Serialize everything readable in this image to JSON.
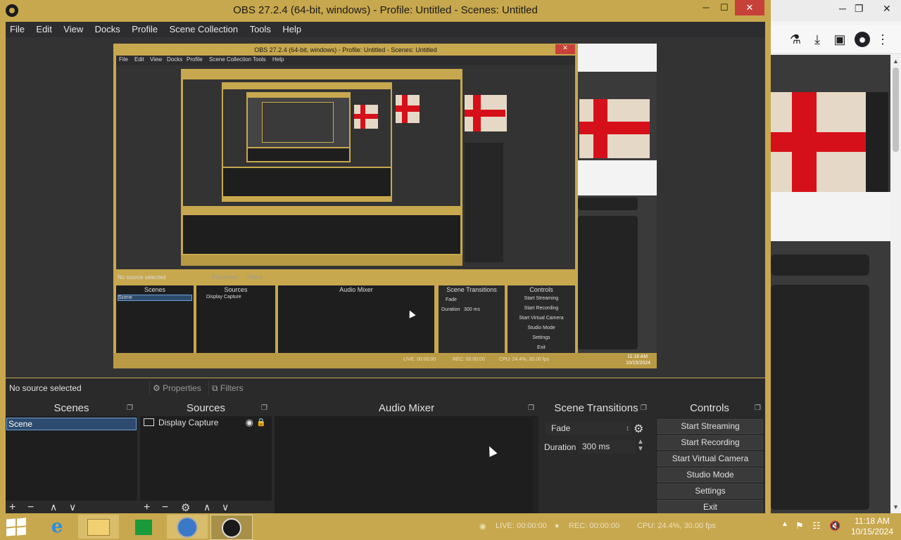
{
  "window": {
    "title": "OBS 27.2.4 (64-bit, windows) - Profile: Untitled - Scenes: Untitled",
    "minimize": "─",
    "maximize": "☐",
    "close": "✕"
  },
  "menu": [
    "File",
    "Edit",
    "View",
    "Docks",
    "Profile",
    "Scene Collection",
    "Tools",
    "Help"
  ],
  "properties_bar": {
    "no_source": "No source selected",
    "properties": "Properties",
    "filters": "Filters"
  },
  "docks": {
    "scenes": {
      "title": "Scenes",
      "items": [
        "Scene"
      ]
    },
    "sources": {
      "title": "Sources",
      "items": [
        "Display Capture"
      ]
    },
    "audio_mixer": {
      "title": "Audio Mixer"
    },
    "scene_transitions": {
      "title": "Scene Transitions",
      "transition": "Fade",
      "duration_label": "Duration",
      "duration_value": "300 ms"
    },
    "controls": {
      "title": "Controls",
      "buttons": [
        "Start Streaming",
        "Start Recording",
        "Start Virtual Camera",
        "Studio Mode",
        "Settings",
        "Exit"
      ]
    }
  },
  "status": {
    "live": "LIVE: 00:00:00",
    "rec": "REC: 00:00:00",
    "cpu": "CPU: 24.4%, 30.00 fps"
  },
  "clock": {
    "time": "11:18 AM",
    "date": "10/15/2024"
  },
  "nested_preview": {
    "title": "OBS 27.2.4 (64-bit, windows) - Profile: Untitled - Scenes: Untitled",
    "menu": [
      "File",
      "Edit",
      "View",
      "Docks",
      "Profile",
      "Scene Collection",
      "Tools",
      "Help"
    ],
    "no_source": "No source selected",
    "properties": "Properties",
    "filters": "Filters",
    "scenes": "Scenes",
    "sources": "Sources",
    "audio_mixer": "Audio Mixer",
    "scene_transitions": "Scene Transitions",
    "controls": "Controls",
    "scene_item": "Scene",
    "source_item": "Display Capture",
    "transition": "Fade",
    "duration_label": "Duration",
    "duration_value": "300 ms",
    "buttons": [
      "Start Streaming",
      "Start Recording",
      "Start Virtual Camera",
      "Studio Mode",
      "Settings",
      "Exit"
    ],
    "live": "LIVE: 00:00:00",
    "rec": "REC: 00:00:00",
    "cpu": "CPU: 24.4%, 30.00 fps",
    "time": "11:18 AM",
    "date": "10/15/2024"
  },
  "colors": {
    "window_frame": "#c8a84e",
    "close_button": "#c7413a",
    "selection": "#2d4b6e",
    "flag_red": "#d6101a"
  }
}
